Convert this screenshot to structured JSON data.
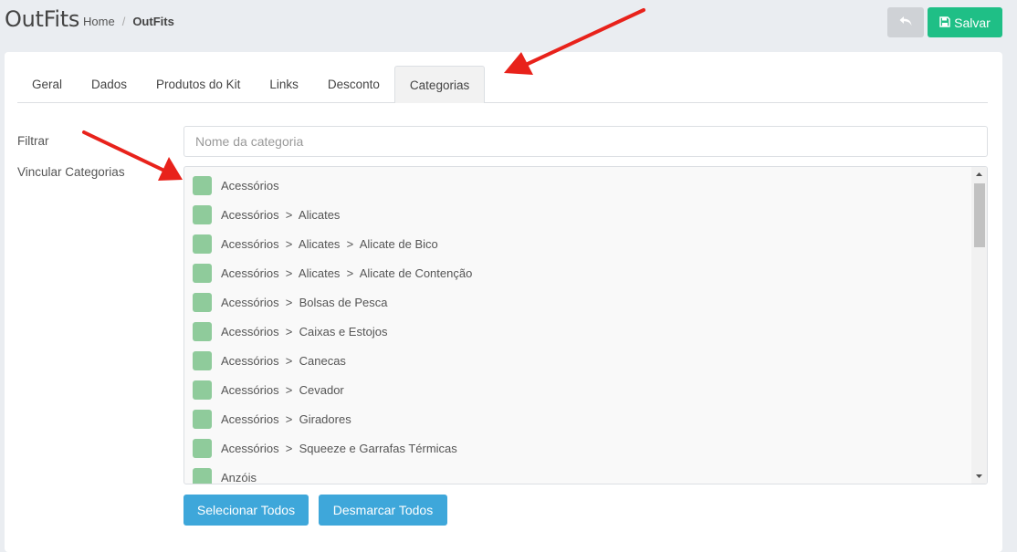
{
  "header": {
    "title": "OutFits",
    "breadcrumb": {
      "home": "Home",
      "separator": "/",
      "current": "OutFits"
    },
    "back_icon": "undo-arrow-icon",
    "save_label": "Salvar",
    "save_icon": "floppy-disk-icon"
  },
  "tabs": [
    {
      "label": "Geral"
    },
    {
      "label": "Dados"
    },
    {
      "label": "Produtos do Kit"
    },
    {
      "label": "Links"
    },
    {
      "label": "Desconto"
    },
    {
      "label": "Categorias",
      "active": true
    }
  ],
  "form": {
    "filter_label": "Filtrar",
    "filter_placeholder": "Nome da categoria",
    "filter_value": "",
    "link_label": "Vincular Categorias"
  },
  "categories": [
    "Acessórios",
    "Acessórios  >  Alicates",
    "Acessórios  >  Alicates  >  Alicate de Bico",
    "Acessórios  >  Alicates  >  Alicate de Contenção",
    "Acessórios  >  Bolsas de Pesca",
    "Acessórios  >  Caixas e Estojos",
    "Acessórios  >  Canecas",
    "Acessórios  >  Cevador",
    "Acessórios  >  Giradores",
    "Acessórios  >  Squeeze e Garrafas Térmicas",
    "Anzóis"
  ],
  "actions": {
    "select_all": "Selecionar Todos",
    "deselect_all": "Desmarcar Todos"
  },
  "colors": {
    "save": "#1fbf86",
    "back": "#cfd2d6",
    "primary": "#3ea7da",
    "checkbox": "#8fcb9b",
    "annotation_arrow": "#e8221b"
  }
}
